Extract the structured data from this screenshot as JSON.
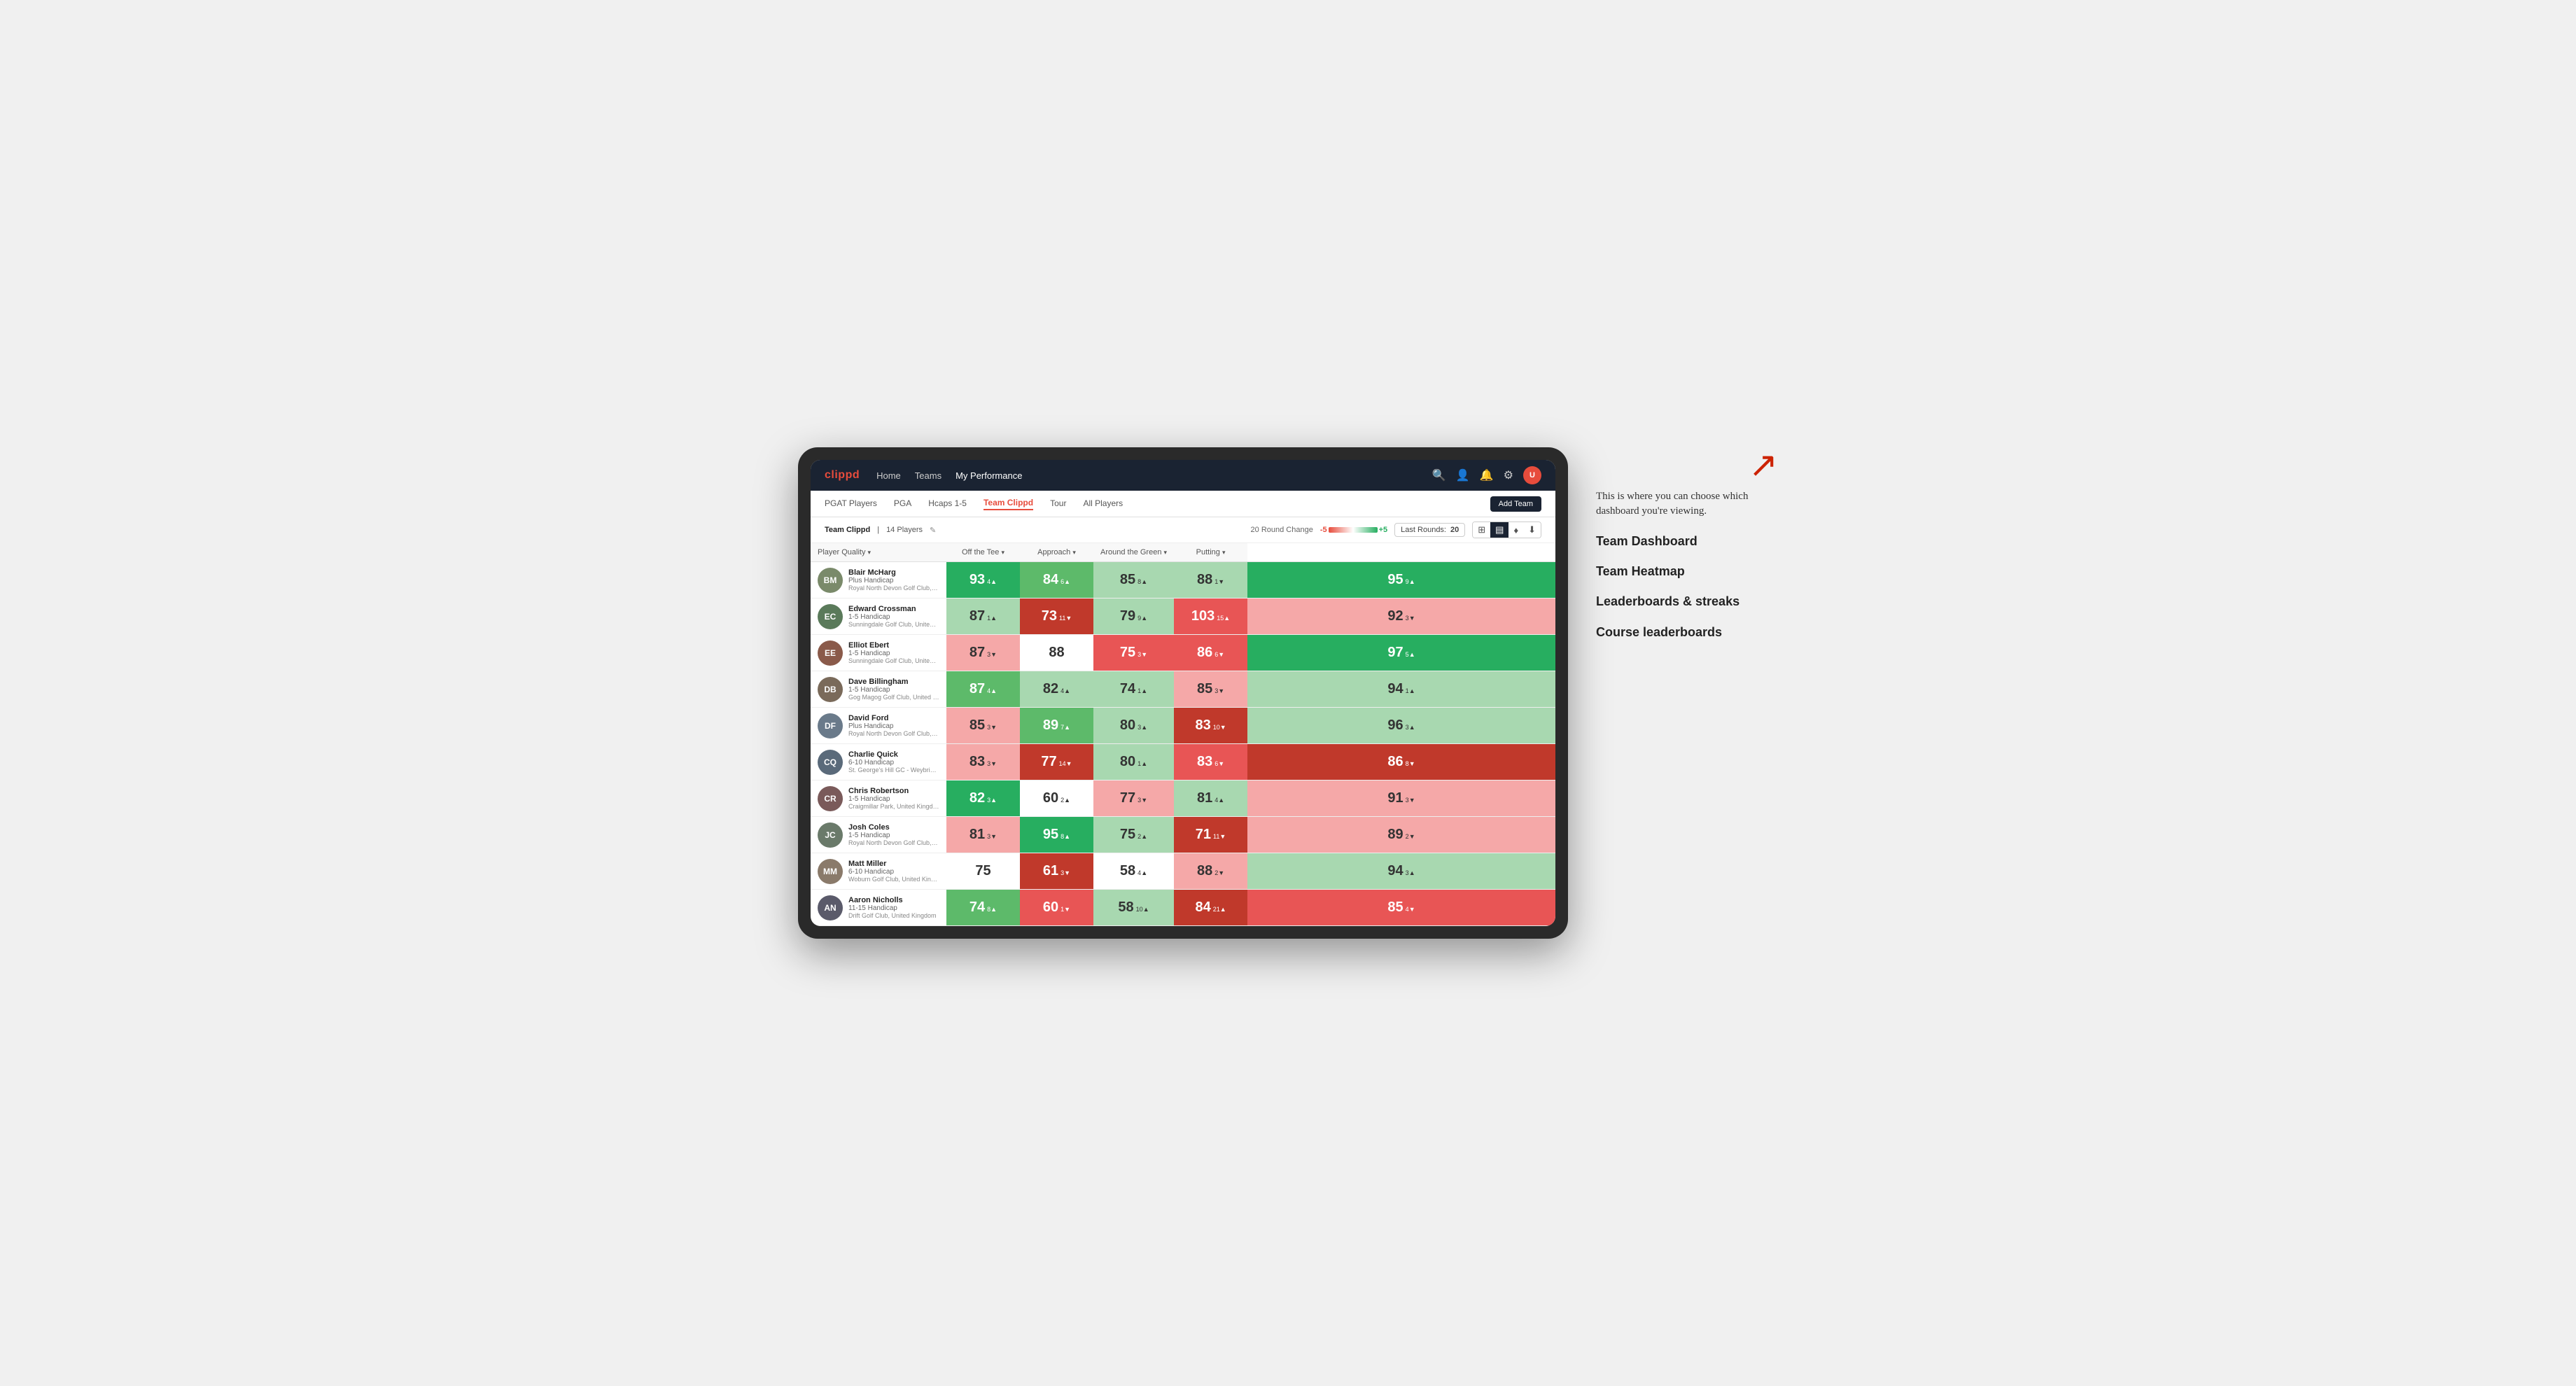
{
  "annotation": {
    "intro": "This is where you can choose which dashboard you're viewing.",
    "items": [
      "Team Dashboard",
      "Team Heatmap",
      "Leaderboards & streaks",
      "Course leaderboards"
    ]
  },
  "nav": {
    "logo": "clippd",
    "links": [
      "Home",
      "Teams",
      "My Performance"
    ],
    "active_link": "My Performance"
  },
  "sub_nav": {
    "links": [
      "PGAT Players",
      "PGA",
      "Hcaps 1-5",
      "Team Clippd",
      "Tour",
      "All Players"
    ],
    "active": "Team Clippd",
    "add_team": "Add Team"
  },
  "team_bar": {
    "name": "Team Clippd",
    "count": "14 Players",
    "round_change_label": "20 Round Change",
    "scale_minus": "-5",
    "scale_plus": "+5",
    "last_rounds_label": "Last Rounds:",
    "last_rounds_value": "20"
  },
  "table": {
    "headers": {
      "player": "Player Quality",
      "off_tee": "Off the Tee",
      "approach": "Approach",
      "around_green": "Around the Green",
      "putting": "Putting"
    },
    "rows": [
      {
        "name": "Blair McHarg",
        "handicap": "Plus Handicap",
        "club": "Royal North Devon Golf Club, United Kingdom",
        "initials": "BM",
        "avatar_color": "#7a8a6a",
        "player_quality": {
          "score": 93,
          "delta": 4,
          "dir": "up",
          "bg": "bg-green-dark"
        },
        "off_tee": {
          "score": 84,
          "delta": 6,
          "dir": "up",
          "bg": "bg-green-mid"
        },
        "approach": {
          "score": 85,
          "delta": 8,
          "dir": "up",
          "bg": "bg-green-light"
        },
        "around_green": {
          "score": 88,
          "delta": 1,
          "dir": "down",
          "bg": "bg-green-light"
        },
        "putting": {
          "score": 95,
          "delta": 9,
          "dir": "up",
          "bg": "bg-green-dark"
        }
      },
      {
        "name": "Edward Crossman",
        "handicap": "1-5 Handicap",
        "club": "Sunningdale Golf Club, United Kingdom",
        "initials": "EC",
        "avatar_color": "#5a7a5a",
        "player_quality": {
          "score": 87,
          "delta": 1,
          "dir": "up",
          "bg": "bg-green-light"
        },
        "off_tee": {
          "score": 73,
          "delta": 11,
          "dir": "down",
          "bg": "bg-red-dark"
        },
        "approach": {
          "score": 79,
          "delta": 9,
          "dir": "up",
          "bg": "bg-green-light"
        },
        "around_green": {
          "score": 103,
          "delta": 15,
          "dir": "up",
          "bg": "bg-red-mid"
        },
        "putting": {
          "score": 92,
          "delta": 3,
          "dir": "down",
          "bg": "bg-red-light"
        }
      },
      {
        "name": "Elliot Ebert",
        "handicap": "1-5 Handicap",
        "club": "Sunningdale Golf Club, United Kingdom",
        "initials": "EE",
        "avatar_color": "#8a5a4a",
        "player_quality": {
          "score": 87,
          "delta": 3,
          "dir": "down",
          "bg": "bg-red-light"
        },
        "off_tee": {
          "score": 88,
          "delta": null,
          "dir": null,
          "bg": "bg-white"
        },
        "approach": {
          "score": 75,
          "delta": 3,
          "dir": "down",
          "bg": "bg-red-mid"
        },
        "around_green": {
          "score": 86,
          "delta": 6,
          "dir": "down",
          "bg": "bg-red-mid"
        },
        "putting": {
          "score": 97,
          "delta": 5,
          "dir": "up",
          "bg": "bg-green-dark"
        }
      },
      {
        "name": "Dave Billingham",
        "handicap": "1-5 Handicap",
        "club": "Gog Magog Golf Club, United Kingdom",
        "initials": "DB",
        "avatar_color": "#7a6a5a",
        "player_quality": {
          "score": 87,
          "delta": 4,
          "dir": "up",
          "bg": "bg-green-mid"
        },
        "off_tee": {
          "score": 82,
          "delta": 4,
          "dir": "up",
          "bg": "bg-green-light"
        },
        "approach": {
          "score": 74,
          "delta": 1,
          "dir": "up",
          "bg": "bg-green-light"
        },
        "around_green": {
          "score": 85,
          "delta": 3,
          "dir": "down",
          "bg": "bg-red-light"
        },
        "putting": {
          "score": 94,
          "delta": 1,
          "dir": "up",
          "bg": "bg-green-light"
        }
      },
      {
        "name": "David Ford",
        "handicap": "Plus Handicap",
        "club": "Royal North Devon Golf Club, United Kingdom",
        "initials": "DF",
        "avatar_color": "#6a7a8a",
        "player_quality": {
          "score": 85,
          "delta": 3,
          "dir": "down",
          "bg": "bg-red-light"
        },
        "off_tee": {
          "score": 89,
          "delta": 7,
          "dir": "up",
          "bg": "bg-green-mid"
        },
        "approach": {
          "score": 80,
          "delta": 3,
          "dir": "up",
          "bg": "bg-green-light"
        },
        "around_green": {
          "score": 83,
          "delta": 10,
          "dir": "down",
          "bg": "bg-red-dark"
        },
        "putting": {
          "score": 96,
          "delta": 3,
          "dir": "up",
          "bg": "bg-green-light"
        }
      },
      {
        "name": "Charlie Quick",
        "handicap": "6-10 Handicap",
        "club": "St. George's Hill GC - Weybridge, Surrey, Uni...",
        "initials": "CQ",
        "avatar_color": "#5a6a7a",
        "player_quality": {
          "score": 83,
          "delta": 3,
          "dir": "down",
          "bg": "bg-red-light"
        },
        "off_tee": {
          "score": 77,
          "delta": 14,
          "dir": "down",
          "bg": "bg-red-dark"
        },
        "approach": {
          "score": 80,
          "delta": 1,
          "dir": "up",
          "bg": "bg-green-light"
        },
        "around_green": {
          "score": 83,
          "delta": 6,
          "dir": "down",
          "bg": "bg-red-mid"
        },
        "putting": {
          "score": 86,
          "delta": 8,
          "dir": "down",
          "bg": "bg-red-dark"
        }
      },
      {
        "name": "Chris Robertson",
        "handicap": "1-5 Handicap",
        "club": "Craigmillar Park, United Kingdom",
        "initials": "CR",
        "avatar_color": "#7a5a5a",
        "player_quality": {
          "score": 82,
          "delta": 3,
          "dir": "up",
          "bg": "bg-green-dark"
        },
        "off_tee": {
          "score": 60,
          "delta": 2,
          "dir": "up",
          "bg": "bg-white"
        },
        "approach": {
          "score": 77,
          "delta": 3,
          "dir": "down",
          "bg": "bg-red-light"
        },
        "around_green": {
          "score": 81,
          "delta": 4,
          "dir": "up",
          "bg": "bg-green-light"
        },
        "putting": {
          "score": 91,
          "delta": 3,
          "dir": "down",
          "bg": "bg-red-light"
        }
      },
      {
        "name": "Josh Coles",
        "handicap": "1-5 Handicap",
        "club": "Royal North Devon Golf Club, United Kingdom",
        "initials": "JC",
        "avatar_color": "#6a7a6a",
        "player_quality": {
          "score": 81,
          "delta": 3,
          "dir": "down",
          "bg": "bg-red-light"
        },
        "off_tee": {
          "score": 95,
          "delta": 8,
          "dir": "up",
          "bg": "bg-green-dark"
        },
        "approach": {
          "score": 75,
          "delta": 2,
          "dir": "up",
          "bg": "bg-green-light"
        },
        "around_green": {
          "score": 71,
          "delta": 11,
          "dir": "down",
          "bg": "bg-red-dark"
        },
        "putting": {
          "score": 89,
          "delta": 2,
          "dir": "down",
          "bg": "bg-red-light"
        }
      },
      {
        "name": "Matt Miller",
        "handicap": "6-10 Handicap",
        "club": "Woburn Golf Club, United Kingdom",
        "initials": "MM",
        "avatar_color": "#8a7a6a",
        "player_quality": {
          "score": 75,
          "delta": null,
          "dir": null,
          "bg": "bg-white"
        },
        "off_tee": {
          "score": 61,
          "delta": 3,
          "dir": "down",
          "bg": "bg-red-dark"
        },
        "approach": {
          "score": 58,
          "delta": 4,
          "dir": "up",
          "bg": "bg-white"
        },
        "around_green": {
          "score": 88,
          "delta": 2,
          "dir": "down",
          "bg": "bg-red-light"
        },
        "putting": {
          "score": 94,
          "delta": 3,
          "dir": "up",
          "bg": "bg-green-light"
        }
      },
      {
        "name": "Aaron Nicholls",
        "handicap": "11-15 Handicap",
        "club": "Drift Golf Club, United Kingdom",
        "initials": "AN",
        "avatar_color": "#5a5a6a",
        "player_quality": {
          "score": 74,
          "delta": 8,
          "dir": "up",
          "bg": "bg-green-mid"
        },
        "off_tee": {
          "score": 60,
          "delta": 1,
          "dir": "down",
          "bg": "bg-red-mid"
        },
        "approach": {
          "score": 58,
          "delta": 10,
          "dir": "up",
          "bg": "bg-green-light"
        },
        "around_green": {
          "score": 84,
          "delta": 21,
          "dir": "up",
          "bg": "bg-red-dark"
        },
        "putting": {
          "score": 85,
          "delta": 4,
          "dir": "down",
          "bg": "bg-red-mid"
        }
      }
    ]
  }
}
